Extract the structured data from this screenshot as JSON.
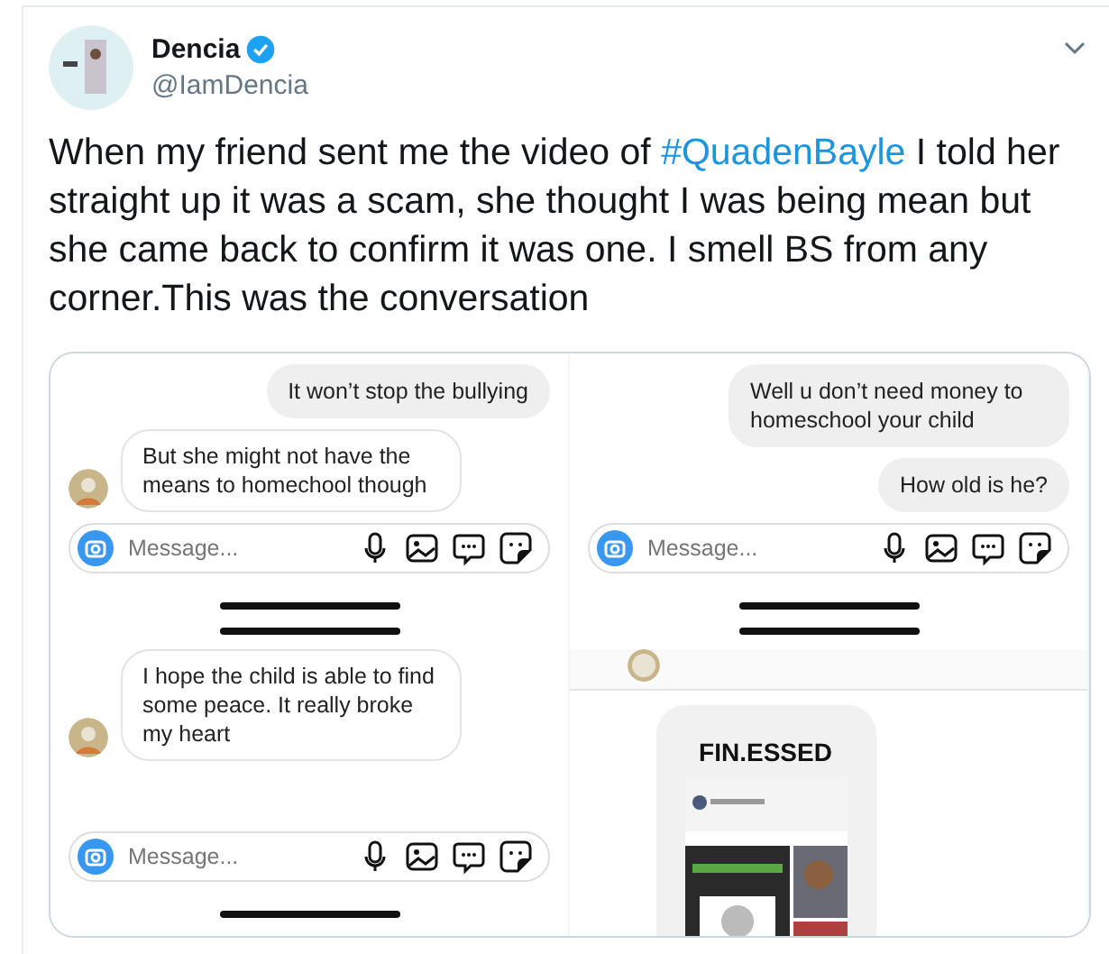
{
  "tweet": {
    "author": {
      "name": "Dencia",
      "verified": true,
      "handle": "@IamDencia"
    },
    "text_before": "When my friend sent me the video of ",
    "hashtag": "#QuadenBayle",
    "text_after": " I told her straight up it was a scam, she thought I was being mean but she came back to confirm it was one. I smell BS from any corner.This was the conversation"
  },
  "panels": [
    {
      "kind": "chat",
      "top_bar": false,
      "messages": [
        {
          "sent": true,
          "text": "It won’t stop the bullying"
        },
        {
          "sent": false,
          "text": "But she might not have the means to homechool though"
        }
      ],
      "composer": {
        "placeholder": "Message..."
      }
    },
    {
      "kind": "chat",
      "top_bar": false,
      "messages": [
        {
          "sent": true,
          "text": "Well u don’t need money to homeschool your child"
        },
        {
          "sent": true,
          "text": "How old is he?"
        }
      ],
      "composer": {
        "placeholder": "Message..."
      }
    },
    {
      "kind": "chat",
      "top_bar": true,
      "messages": [
        {
          "sent": false,
          "text": "I hope the child is able to find some peace. It really broke my heart"
        }
      ],
      "composer": {
        "placeholder": "Message..."
      }
    },
    {
      "kind": "post",
      "top_bar": true,
      "title": "FIN.ESSED"
    }
  ]
}
